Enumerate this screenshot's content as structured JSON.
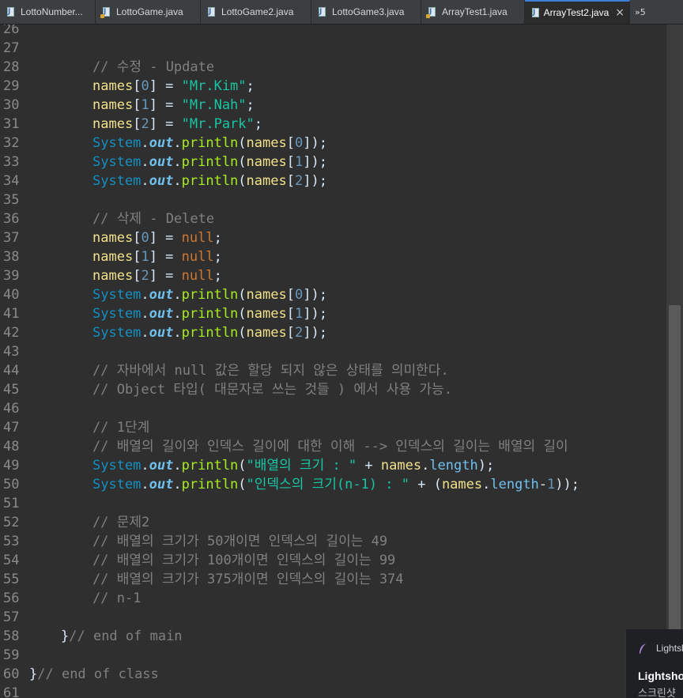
{
  "tabs": [
    {
      "label": "LottoNumber...",
      "active": false
    },
    {
      "label": "LottoGame.java",
      "active": false
    },
    {
      "label": "LottoGame2.java",
      "active": false
    },
    {
      "label": "LottoGame3.java",
      "active": false
    },
    {
      "label": "ArrayTest1.java",
      "active": false
    },
    {
      "label": "ArrayTest2.java",
      "active": true
    }
  ],
  "tab_overflow": "»5",
  "line_numbers": [
    "26",
    "27",
    "28",
    "29",
    "30",
    "31",
    "32",
    "33",
    "34",
    "35",
    "36",
    "37",
    "38",
    "39",
    "40",
    "41",
    "42",
    "43",
    "44",
    "45",
    "46",
    "47",
    "48",
    "49",
    "50",
    "51",
    "52",
    "53",
    "54",
    "55",
    "56",
    "57",
    "58",
    "59",
    "60",
    "61"
  ],
  "code": {
    "c28": "// 수정 - Update",
    "c36": "// 삭제 - Delete",
    "c44": "// 자바에서 null 값은 할당 되지 않은 상태를 의미한다.",
    "c45": "// Object 타입( 대문자로 쓰는 것들 ) 에서 사용 가능.",
    "c47": "// 1단계",
    "c48": "// 배열의 길이와 인덱스 길이에 대한 이해 --> 인덱스의 길이는 배열의 길이",
    "c52": "// 문제2",
    "c53": "// 배열의 크기가 50개이면 인덱스의 길이는 49",
    "c54": "// 배열의 크기가 100개이면 인덱스의 길이는 99",
    "c55": "// 배열의 크기가 375개이면 인덱스의 길이는 374",
    "c56": "// n-1",
    "c58": "// end of main",
    "c60": "// end of class",
    "names": "names",
    "system": "System",
    "out": "out",
    "println": "println",
    "null": "null",
    "length": "length",
    "str_kim": "\"Mr.Kim\"",
    "str_nah": "\"Mr.Nah\"",
    "str_park": "\"Mr.Park\"",
    "str_size": "\"배열의 크기 : \"",
    "str_index": "\"인덱스의 크기(n-1) : \"",
    "i0": "0",
    "i1": "1",
    "i2": "2"
  },
  "popup": {
    "app_name": "Lightshot",
    "title": "Lightshot",
    "subtitle": "스크린샷"
  },
  "colors": {
    "background": "#2f2f2f",
    "comment": "#808080",
    "variable": "#f0e28a",
    "string": "#17c6a3",
    "keyword": "#cc7832",
    "class": "#1290c3",
    "method": "#a7ec21",
    "active_tab_accent": "#3a7fd5"
  }
}
